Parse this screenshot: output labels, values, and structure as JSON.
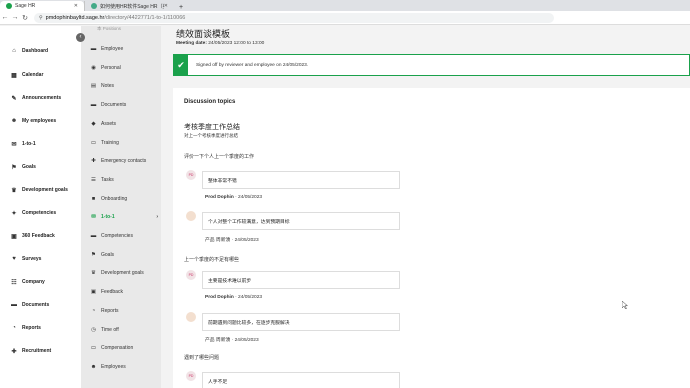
{
  "browser": {
    "tabs": [
      {
        "label": "Sage HR",
        "active": true
      },
      {
        "label": "如何使用HR软件Sage HR（英）",
        "active": false
      }
    ],
    "url_host": "pmdophinbayltd.sage.hr",
    "url_path": "/directory/4422771/1-to-1/110066"
  },
  "leftnav": {
    "items": [
      {
        "label": "Dashboard",
        "icon": "dashboard-icon",
        "glyph": "⌂"
      },
      {
        "label": "Calendar",
        "icon": "calendar-icon",
        "glyph": "▦"
      },
      {
        "label": "Announcements",
        "icon": "megaphone-icon",
        "glyph": "✎"
      },
      {
        "label": "My employees",
        "icon": "people-icon",
        "glyph": "☻"
      },
      {
        "label": "1-to-1",
        "icon": "chat-icon",
        "glyph": "✉"
      },
      {
        "label": "Goals",
        "icon": "flag-icon",
        "glyph": "⚑"
      },
      {
        "label": "Development goals",
        "icon": "trophy-icon",
        "glyph": "♛"
      },
      {
        "label": "Competencies",
        "icon": "competencies-icon",
        "glyph": "✦"
      },
      {
        "label": "360 Feedback",
        "icon": "feedback-icon",
        "glyph": "▣"
      },
      {
        "label": "Surveys",
        "icon": "survey-icon",
        "glyph": "♥"
      },
      {
        "label": "Company",
        "icon": "company-icon",
        "glyph": "☷"
      },
      {
        "label": "Documents",
        "icon": "folder-icon",
        "glyph": "▬"
      },
      {
        "label": "Reports",
        "icon": "reports-icon",
        "glyph": "◔"
      },
      {
        "label": "Recruitment",
        "icon": "recruitment-icon",
        "glyph": "✚"
      }
    ]
  },
  "subnav": {
    "top_cut": "本 Positions",
    "items": [
      {
        "label": "Employee",
        "icon": "briefcase-icon",
        "glyph": "▬"
      },
      {
        "label": "Personal",
        "icon": "eye-icon",
        "glyph": "◉"
      },
      {
        "label": "Notes",
        "icon": "note-icon",
        "glyph": "▤"
      },
      {
        "label": "Documents",
        "icon": "folder-icon",
        "glyph": "▬"
      },
      {
        "label": "Assets",
        "icon": "tag-icon",
        "glyph": "◆"
      },
      {
        "label": "Training",
        "icon": "training-icon",
        "glyph": "▭"
      },
      {
        "label": "Emergency contacts",
        "icon": "emergency-icon",
        "glyph": "✚"
      },
      {
        "label": "Tasks",
        "icon": "tasks-icon",
        "glyph": "☰"
      },
      {
        "label": "Onboarding",
        "icon": "onboarding-icon",
        "glyph": "■"
      },
      {
        "label": "1-to-1",
        "icon": "chat-icon",
        "glyph": "✉",
        "active": true
      },
      {
        "label": "Competencies",
        "icon": "competencies-icon",
        "glyph": "▬"
      },
      {
        "label": "Goals",
        "icon": "flag-icon",
        "glyph": "⚑"
      },
      {
        "label": "Development goals",
        "icon": "trophy-icon",
        "glyph": "♛"
      },
      {
        "label": "Feedback",
        "icon": "feedback-icon",
        "glyph": "▣"
      },
      {
        "label": "Reports",
        "icon": "reports-icon",
        "glyph": "◔"
      },
      {
        "label": "Time off",
        "icon": "clock-icon",
        "glyph": "◷"
      },
      {
        "label": "Compensation",
        "icon": "money-icon",
        "glyph": "▭"
      },
      {
        "label": "Employees",
        "icon": "people-icon",
        "glyph": "☻"
      }
    ]
  },
  "main": {
    "title": "绩效面谈模板",
    "meeting_date_label": "Meeting date:",
    "meeting_date_value": "24/05/2023 12:00 to 13:00",
    "signed_text": "Signed off by reviewer and employee on 24/05/2023.",
    "discussion_title": "Discussion topics",
    "topic_title": "考核季度工作总结",
    "topic_desc": "对上一个考核季度进行总结",
    "questions": [
      {
        "text": "评价一下个人上一个季度的工作",
        "answers": [
          {
            "avatar": "PD",
            "style": "pd",
            "text": "整体非常不错",
            "author": "Prod Dophin",
            "date": "· 24/05/2023",
            "bold": true
          },
          {
            "avatar": "",
            "style": "cn",
            "text": "个人对整个工作较满意，达到预期目标",
            "author": "产品 周新湧",
            "date": "· 24/05/2023",
            "bold": false
          }
        ]
      },
      {
        "text": "上一个季度的不足有哪些",
        "answers": [
          {
            "avatar": "PD",
            "style": "pd",
            "text": "主要是技术难以前步",
            "author": "Prod Dophin",
            "date": "· 24/05/2023",
            "bold": true
          },
          {
            "avatar": "",
            "style": "cn",
            "text": "前期遇到问题比较多，在逐步克服解决",
            "author": "产品 周新湧",
            "date": "· 24/05/2023",
            "bold": false
          }
        ]
      },
      {
        "text": "遇到了哪些问题",
        "answers": [
          {
            "avatar": "PD",
            "style": "pd",
            "text": "人手不足",
            "author": "",
            "date": "",
            "bold": true
          }
        ]
      }
    ]
  },
  "colors": {
    "accent": "#1aa14b",
    "nav_bg": "#ffffff",
    "subnav_bg": "#e9e9e9"
  }
}
